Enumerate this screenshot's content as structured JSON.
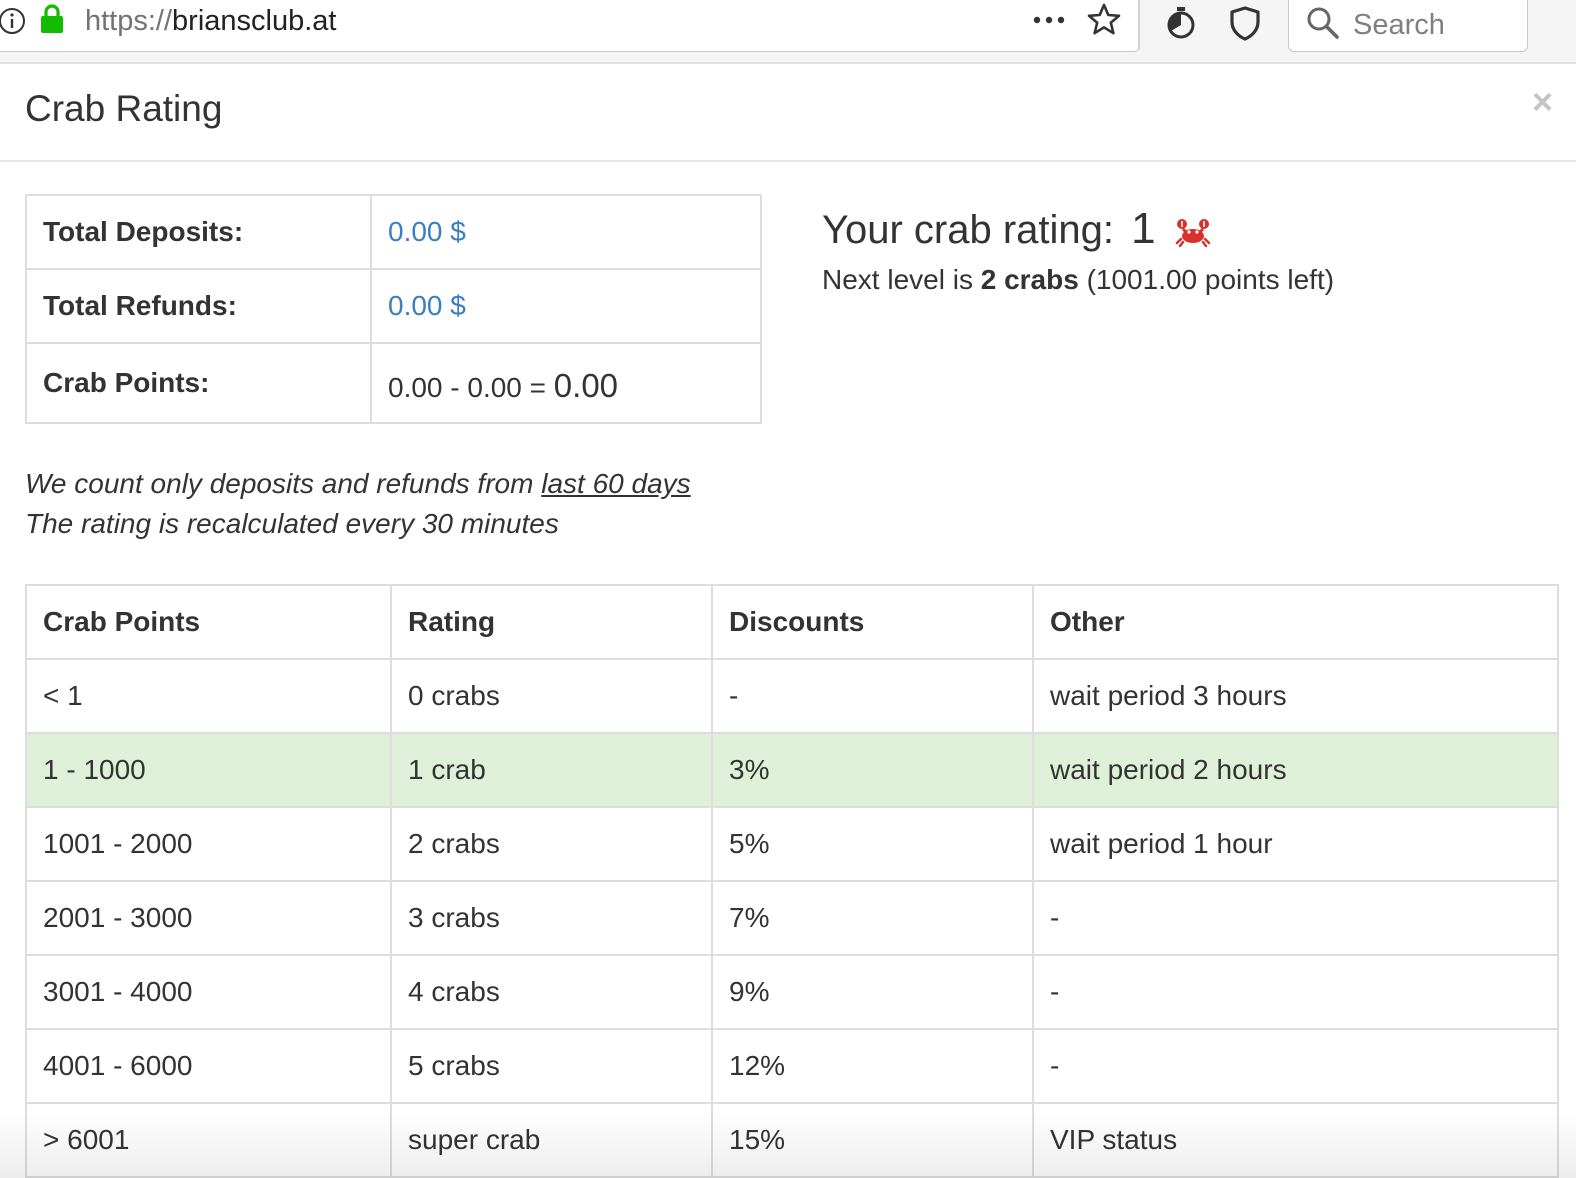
{
  "browser": {
    "url_scheme": "https://",
    "url_host": "briansclub.at",
    "search_placeholder": "Search"
  },
  "modal": {
    "title": "Crab Rating",
    "close_label": "×"
  },
  "summary": {
    "rows": [
      {
        "label": "Total Deposits:",
        "value": "0.00 $"
      },
      {
        "label": "Total Refunds:",
        "value": "0.00 $"
      },
      {
        "label": "Crab Points:",
        "value": "0.00 - 0.00 = ",
        "result": "0.00"
      }
    ]
  },
  "rating": {
    "heading": "Your crab rating:",
    "value": "1",
    "next_prefix": "Next level is ",
    "next_level": "2 crabs",
    "next_suffix": " (1001.00 points left)"
  },
  "notes": {
    "line1_prefix": "We count only deposits and refunds from ",
    "line1_link": "last 60 days",
    "line2": "The rating is recalculated every 30 minutes"
  },
  "levels": {
    "headers": [
      "Crab Points",
      "Rating",
      "Discounts",
      "Other"
    ],
    "current_row": 1,
    "rows": [
      [
        "< 1",
        "0 crabs",
        "-",
        "wait period 3 hours"
      ],
      [
        "1 - 1000",
        "1 crab",
        "3%",
        "wait period 2 hours"
      ],
      [
        "1001 - 2000",
        "2 crabs",
        "5%",
        "wait period 1 hour"
      ],
      [
        "2001 - 3000",
        "3 crabs",
        "7%",
        "-"
      ],
      [
        "3001 - 4000",
        "4 crabs",
        "9%",
        "-"
      ],
      [
        "4001 - 6000",
        "5 crabs",
        "12%",
        "-"
      ],
      [
        "> 6001",
        "super crab",
        "15%",
        "VIP status"
      ]
    ]
  },
  "colors": {
    "link_blue": "#3a7fc1",
    "current_row_bg": "#dff0d8",
    "lock_green": "#12bc00",
    "crab_red": "#d9302b"
  },
  "icons": [
    "info-icon",
    "lock-icon",
    "more-icon",
    "star-icon",
    "timer-icon",
    "shield-icon",
    "search-icon",
    "close-icon",
    "crab-icon"
  ]
}
